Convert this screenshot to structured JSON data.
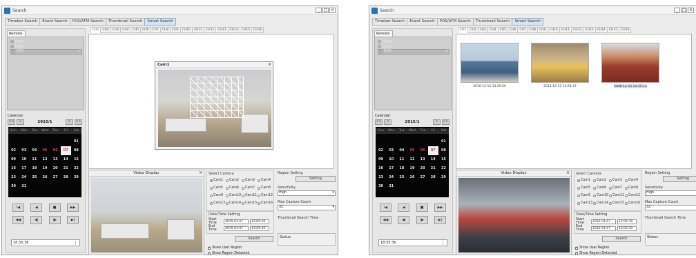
{
  "windows": [
    {
      "title": "Search",
      "controls": [
        "_",
        "□",
        "×"
      ],
      "tabs": [
        "Timebar Search",
        "Event Search",
        "POS/ATM Search",
        "Thumbnail Search",
        "Smart Search"
      ],
      "active_tab": 4,
      "remote_tab": "Remote",
      "tree_items": [
        "DVR1",
        "DVR2",
        "DVR"
      ],
      "calendar": {
        "label": "Calendar",
        "prev_labels": [
          "<<",
          "<"
        ],
        "next_labels": [
          ">",
          ">>"
        ],
        "month": "2015/1",
        "weekdays": [
          "Sun",
          "Mon",
          "Tue",
          "Wed",
          "Thu",
          "Fri",
          "Sat"
        ],
        "days": [
          "",
          "",
          "",
          "",
          "",
          "",
          "01",
          "02",
          "03",
          "04",
          "05",
          "06",
          "07",
          "08",
          "09",
          "10",
          "11",
          "12",
          "13",
          "14",
          "15",
          "16",
          "17",
          "18",
          "19",
          "20",
          "21",
          "22",
          "23",
          "24",
          "25",
          "26",
          "27",
          "28",
          "29",
          "30",
          "31"
        ],
        "record_days": [
          "05",
          "06"
        ],
        "selected_day": "07"
      },
      "playback_row1": [
        "I◀",
        "◀",
        "■",
        "▶▶"
      ],
      "playback_row2": [
        "◀◀",
        "◀|",
        "|▶",
        "▶|"
      ],
      "time_value": "18:35:36",
      "channels": [
        "CH1",
        "CH2",
        "CH3",
        "CH4",
        "CH5",
        "CH6",
        "CH7",
        "CH8",
        "CH9",
        "CH10",
        "CH11",
        "CH12",
        "CH13",
        "CH14",
        "CH15",
        "CH16"
      ],
      "popup_title": "Cam1",
      "popup_close": "×",
      "video_display_title": "Video Display",
      "video_display_close": "×",
      "select_camera_label": "Select Camera",
      "cameras": [
        "Cam1",
        "Cam2",
        "Cam3",
        "Cam4",
        "Cam5",
        "Cam6",
        "Cam7",
        "Cam8",
        "Cam9",
        "Cam10",
        "Cam11",
        "Cam12",
        "Cam13",
        "Cam14",
        "Cam15",
        "Cam16"
      ],
      "selected_camera": "Cam1",
      "datetime_label": "Date/Time Setting",
      "start_time_label": "Start Time",
      "end_time_label": "End Time",
      "start_date": "2015-01-07",
      "start_clock": "12:05:30",
      "end_date": "2015-01-07",
      "end_clock": "13:05:30",
      "search_label": "Search",
      "show_user_region_label": "Show User Region",
      "show_region_detected_label": "Show Region Detected",
      "region_setting_label": "Region Setting",
      "setting_label": "Setting",
      "sensitivity_label": "Sensitivity",
      "sensitivity_value": "High",
      "max_capture_label": "Max Capture Count",
      "max_capture_value": "32",
      "thumb_search_time_label": "Thumbnail Search Time",
      "status_label": "Status"
    },
    {
      "title": "Search",
      "controls": [
        "_",
        "□",
        "×"
      ],
      "tabs": [
        "Timebar Search",
        "Event Search",
        "POS/ATM Search",
        "Thumbnail Search",
        "Smart Search"
      ],
      "active_tab": 4,
      "remote_tab": "Remote",
      "tree_items": [
        "DVR1",
        "DVR2",
        "DVR"
      ],
      "calendar": {
        "label": "Calendar",
        "prev_labels": [
          "<<",
          "<"
        ],
        "next_labels": [
          ">",
          ">>"
        ],
        "month": "2015/1",
        "weekdays": [
          "Sun",
          "Mon",
          "Tue",
          "Wed",
          "Thu",
          "Fri",
          "Sat"
        ],
        "days": [
          "",
          "",
          "",
          "",
          "",
          "",
          "01",
          "02",
          "03",
          "04",
          "05",
          "06",
          "07",
          "08",
          "09",
          "10",
          "11",
          "12",
          "13",
          "14",
          "15",
          "16",
          "17",
          "18",
          "19",
          "20",
          "21",
          "22",
          "23",
          "24",
          "25",
          "26",
          "27",
          "28",
          "29",
          "30",
          "31"
        ],
        "record_days": [
          "05",
          "06"
        ],
        "selected_day": "07"
      },
      "playback_row1": [
        "I◀",
        "◀",
        "■",
        "▶▶"
      ],
      "playback_row2": [
        "◀◀",
        "◀|",
        "|▶",
        "▶|"
      ],
      "time_value": "18:35:36",
      "channels": [
        "CH1",
        "CH2",
        "CH3",
        "CH4",
        "CH5",
        "CH6",
        "CH7",
        "CH8",
        "CH9",
        "CH10",
        "CH11",
        "CH12",
        "CH13",
        "CH14",
        "CH15",
        "CH16"
      ],
      "thumbnails": [
        "2010-12-15 13:29:59",
        "2013-12-15 14:05:47",
        "2008-12-15 14:35:14"
      ],
      "selected_thumbnail": 2,
      "video_display_title": "Video Display",
      "video_display_close": "×",
      "select_camera_label": "Select Camera",
      "cameras": [
        "Cam1",
        "Cam2",
        "Cam3",
        "Cam4",
        "Cam5",
        "Cam6",
        "Cam7",
        "Cam8",
        "Cam9",
        "Cam10",
        "Cam11",
        "Cam12",
        "Cam13",
        "Cam14",
        "Cam15",
        "Cam16"
      ],
      "selected_camera": "Cam1",
      "datetime_label": "Date/Time Setting",
      "start_time_label": "Start Time",
      "end_time_label": "End Time",
      "start_date": "2015-01-07",
      "start_clock": "12:05:30",
      "end_date": "2015-01-07",
      "end_clock": "13:05:30",
      "search_label": "Search",
      "show_user_region_label": "Show User Region",
      "show_region_detected_label": "Show Region Detected",
      "region_setting_label": "Region Setting",
      "setting_label": "Setting",
      "sensitivity_label": "Sensitivity",
      "sensitivity_value": "High",
      "max_capture_label": "Max Capture Count",
      "max_capture_value": "32",
      "thumb_search_time_label": "Thumbnail Search Time",
      "status_label": "Status"
    }
  ],
  "colors": {
    "accent": "#2b6fb8",
    "record_day": "#e0443a",
    "selected_day": "#d02a8a",
    "calendar_bg": "#050505",
    "active_tab_bg": "#d6e3f2"
  }
}
